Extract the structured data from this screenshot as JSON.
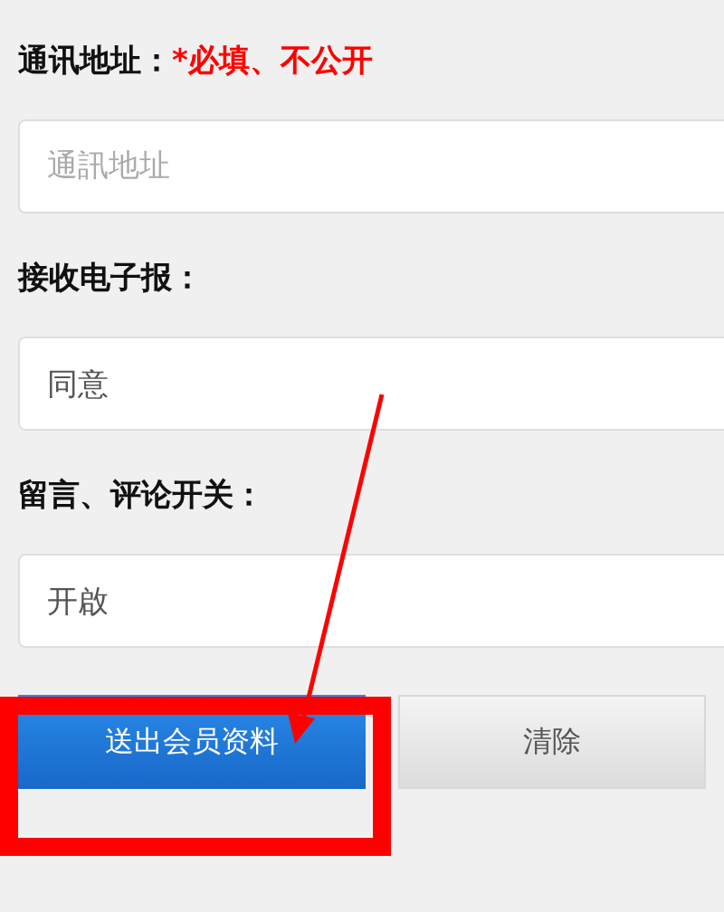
{
  "fields": [
    {
      "label": "通讯地址：",
      "note": "*必填、不公开",
      "placeholder": "通訊地址"
    },
    {
      "label": "接收电子报：",
      "value": "同意"
    },
    {
      "label": "留言、评论开关：",
      "value": "开啟"
    }
  ],
  "buttons": [
    {
      "label": "送出会员资料",
      "kind": "primary"
    },
    {
      "label": "清除",
      "kind": "secondary"
    }
  ]
}
